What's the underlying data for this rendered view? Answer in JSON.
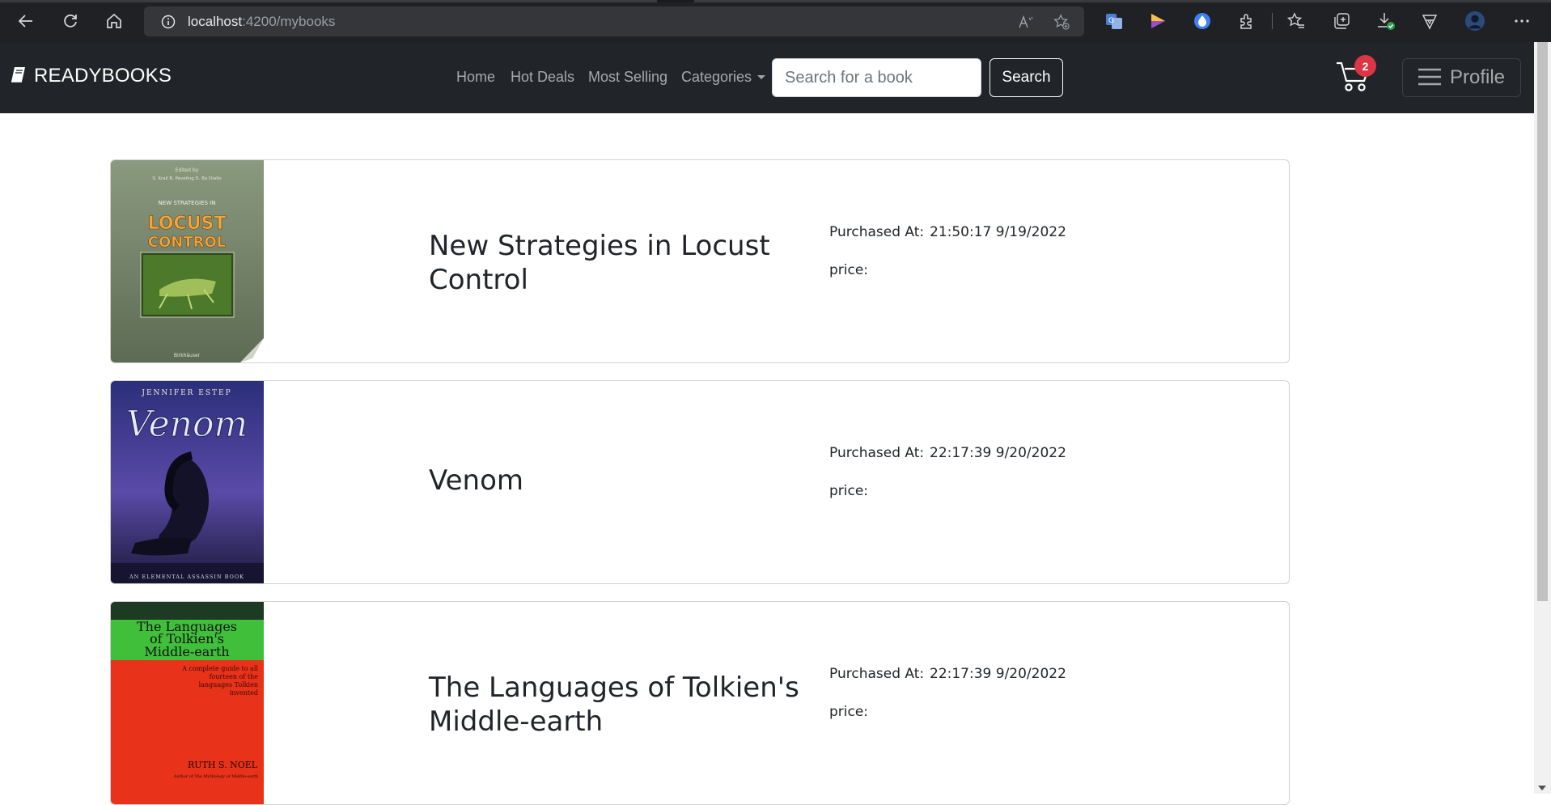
{
  "browser": {
    "url_host": "localhost",
    "url_path": ":4200/mybooks",
    "icons": [
      "back-icon",
      "refresh-icon",
      "home-icon",
      "site-info-icon",
      "read-aloud-icon",
      "add-favorite-icon",
      "translate-extension-icon",
      "color-extension-icon",
      "drop-extension-icon",
      "extensions-icon",
      "favorites-icon",
      "collections-icon",
      "downloads-icon",
      "browser-essentials-icon",
      "profile-avatar-icon",
      "more-menu-icon"
    ]
  },
  "navbar": {
    "brand": "READYBOOKS",
    "links": [
      "Home",
      "Hot Deals",
      "Most Selling",
      "Categories"
    ],
    "search_placeholder": "Search for a book",
    "search_value": "",
    "search_button": "Search",
    "cart_count": "2",
    "profile_label": "Profile",
    "colors": {
      "bg": "#212529",
      "badge": "#dc3545"
    }
  },
  "books": [
    {
      "title": "New Strategies in Locust Control",
      "purchased_label": "Purchased At:",
      "purchased_at": "21:50:17 9/19/2022",
      "price_label": "price:",
      "price": "",
      "cover": {
        "top_text": "Edited by",
        "editors": "S. Krall   R. Peveling   D. Ba Diallo",
        "line1": "NEW STRATEGIES IN",
        "line2": "LOCUST",
        "line3": "CONTROL",
        "publisher": "Birkhäuser"
      }
    },
    {
      "title": "Venom",
      "purchased_label": "Purchased At:",
      "purchased_at": "22:17:39 9/20/2022",
      "price_label": "price:",
      "price": "",
      "cover": {
        "author": "JENNIFER ESTEP",
        "title": "Venom",
        "tagline": "AN ELEMENTAL ASSASSIN BOOK"
      }
    },
    {
      "title": "The Languages of Tolkien's Middle-earth",
      "purchased_label": "Purchased At:",
      "purchased_at": "22:17:39 9/20/2022",
      "price_label": "price:",
      "price": "",
      "cover": {
        "title_line1": "The Languages",
        "title_line2": "of Tolkien's",
        "title_line3": "Middle-earth",
        "blurb": "A complete guide to all fourteen of the languages Tolkien invented",
        "author": "RUTH S. NOEL",
        "author_note": "Author of The Mythology of Middle-earth"
      }
    }
  ]
}
